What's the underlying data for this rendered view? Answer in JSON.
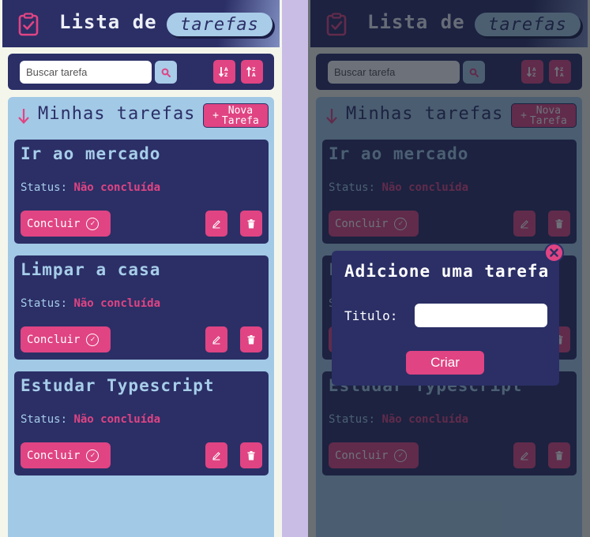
{
  "app": {
    "title": "Lista de",
    "title_highlight": "tarefas"
  },
  "search": {
    "placeholder": "Buscar tarefa"
  },
  "list": {
    "title": "Minhas tarefas",
    "new_task_label": "Nova Tarefa",
    "new_task_line1": "Nova",
    "new_task_line2": "Tarefa",
    "new_task_plus": "+"
  },
  "tasks": [
    {
      "title": "Ir ao mercado",
      "status_label": "Status:",
      "status_value": "Não concluída",
      "complete_label": "Concluir"
    },
    {
      "title": "Limpar a casa",
      "status_label": "Status:",
      "status_value": "Não concluída",
      "complete_label": "Concluir"
    },
    {
      "title": "Estudar Typescript",
      "status_label": "Status:",
      "status_value": "Não concluída",
      "complete_label": "Concluir"
    }
  ],
  "modal": {
    "title": "Adicione uma tarefa",
    "field_label": "Titulo:",
    "create_label": "Criar"
  },
  "colors": {
    "navy": "#2b2f66",
    "pink": "#e04483",
    "light_blue": "#a2c9e6",
    "background": "#c9bde6"
  },
  "icons": [
    "clipboard-check-icon",
    "search-icon",
    "sort-asc-icon",
    "sort-desc-icon",
    "arrow-down-icon",
    "check-circle-icon",
    "edit-icon",
    "trash-icon",
    "close-icon"
  ]
}
